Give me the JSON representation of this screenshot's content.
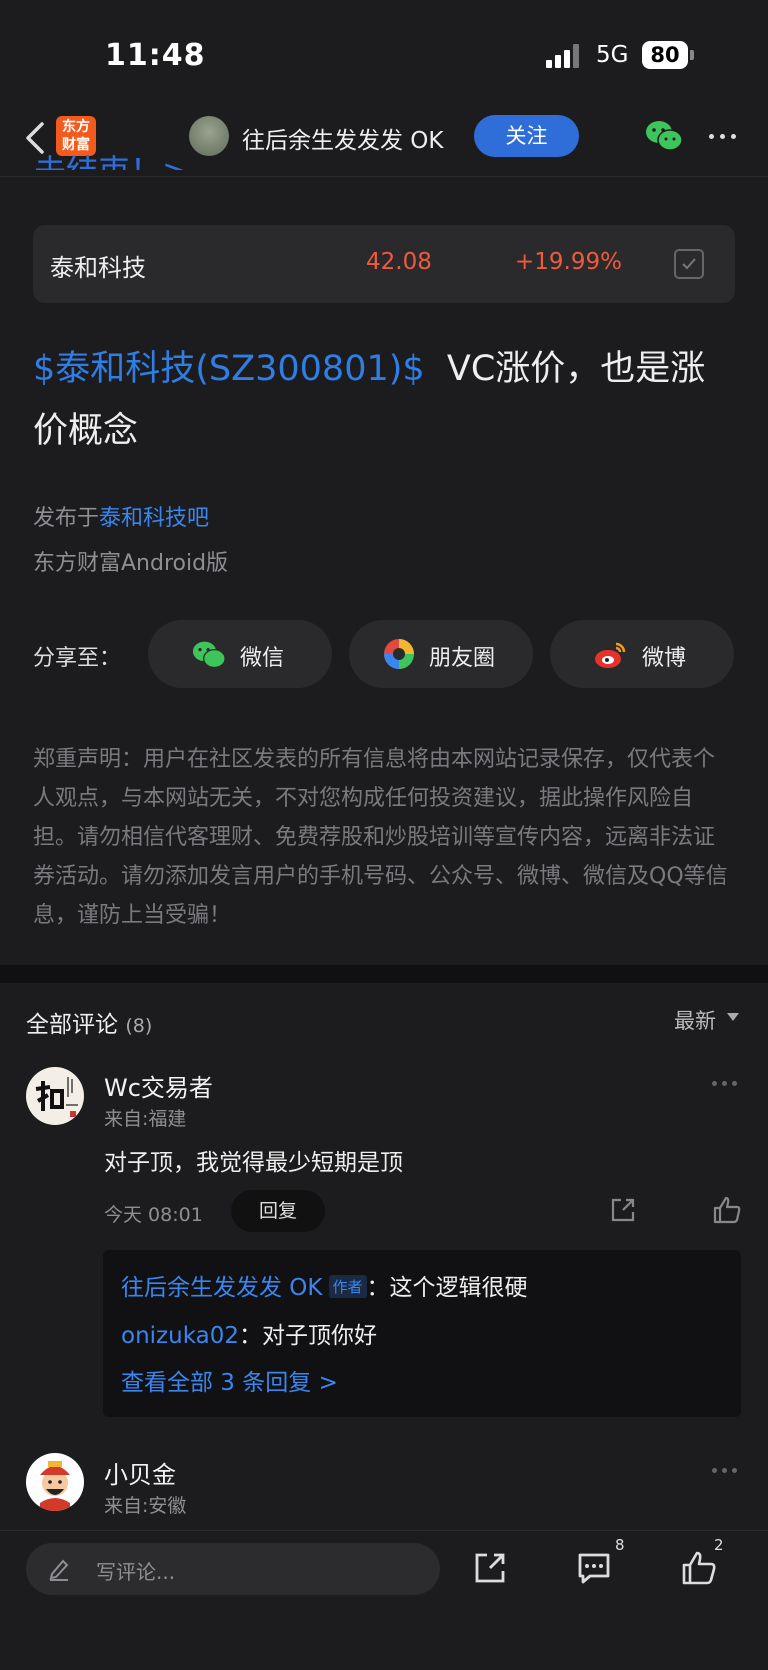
{
  "status_bar": {
    "time": "11:48",
    "network": "5G",
    "battery": "80"
  },
  "header": {
    "logo_line1": "东方",
    "logo_line2": "财富",
    "author_name": "往后余生发发发 OK",
    "follow_label": "关注"
  },
  "cutoff_text": "未结束！>",
  "stock": {
    "name": "泰和科技",
    "price": "42.08",
    "change": "+19.99%"
  },
  "post": {
    "tag": "$泰和科技(SZ300801)$",
    "text": "VC涨价，也是涨价概念",
    "published_prefix": "发布于",
    "published_bar": "泰和科技吧",
    "client": "东方财富Android版"
  },
  "share": {
    "label": "分享至：",
    "options": [
      {
        "label": "微信",
        "icon": "wechat-icon"
      },
      {
        "label": "朋友圈",
        "icon": "moments-icon"
      },
      {
        "label": "微博",
        "icon": "weibo-icon"
      }
    ]
  },
  "disclaimer": "郑重声明：用户在社区发表的所有信息将由本网站记录保存，仅代表个人观点，与本网站无关，不对您构成任何投资建议，据此操作风险自担。请勿相信代客理财、免费荐股和炒股培训等宣传内容，远离非法证券活动。请勿添加发言用户的手机号码、公众号、微博、微信及QQ等信息，谨防上当受骗！",
  "comments_header": {
    "title": "全部评论",
    "count": "(8)",
    "sort": "最新"
  },
  "comments": [
    {
      "name": "Wc交易者",
      "location": "来自:福建",
      "text": "对子顶，我觉得最少短期是顶",
      "time": "今天 08:01",
      "reply_label": "回复",
      "replies": [
        {
          "who": "往后余生发发发 OK",
          "badge": "作者",
          "sep": "：",
          "text": "这个逻辑很硬"
        },
        {
          "who": "onizuka02",
          "sep": "：",
          "text": "对子顶你好"
        }
      ],
      "see_all": "查看全部 3 条回复 >"
    },
    {
      "name": "小贝金",
      "location": "来自:安徽"
    }
  ],
  "bottom_bar": {
    "placeholder": "写评论...",
    "comment_count": "8",
    "like_count": "2"
  },
  "colors": {
    "accent": "#2f6ed9",
    "up": "#f05a3c",
    "link": "#3a86ef",
    "background": "#1c1c1e"
  }
}
